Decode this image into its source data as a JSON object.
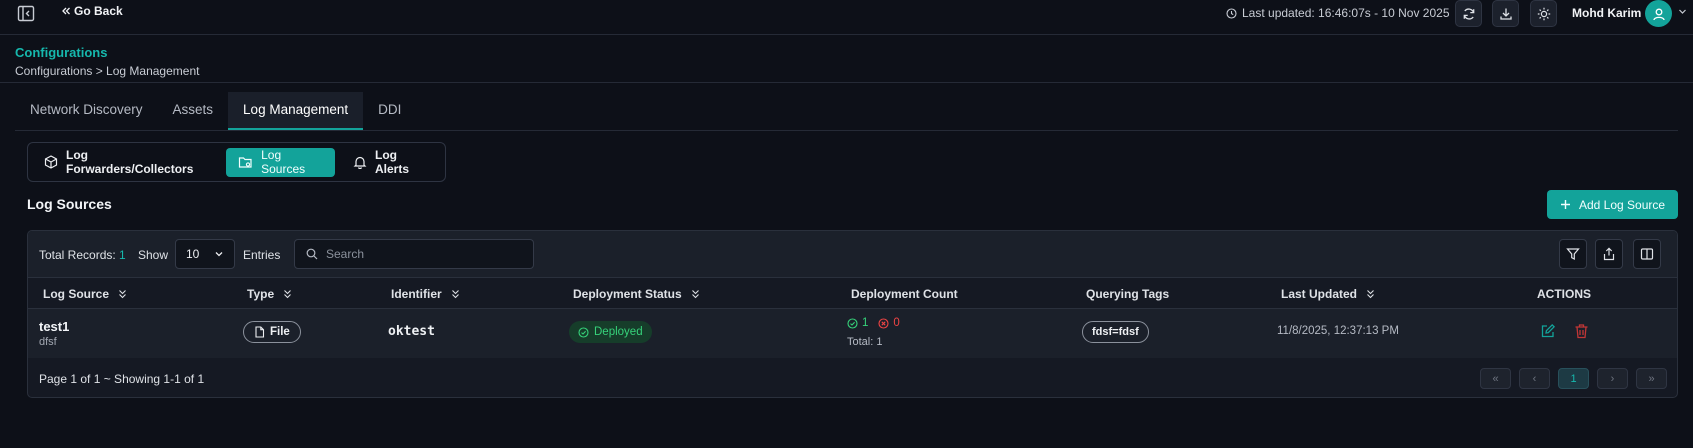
{
  "topbar": {
    "go_back": "Go Back",
    "last_updated": "Last updated: 16:46:07s - 10 Nov 2025",
    "user_name": "Mohd Karim"
  },
  "header": {
    "title": "Configurations",
    "breadcrumb": "Configurations > Log Management"
  },
  "tabs": [
    "Network Discovery",
    "Assets",
    "Log Management",
    "DDI"
  ],
  "active_tab": "Log Management",
  "subtabs": [
    "Log Forwarders/Collectors",
    "Log Sources",
    "Log Alerts"
  ],
  "active_subtab": "Log Sources",
  "section": {
    "title": "Log Sources",
    "add_button": "Add Log Source"
  },
  "toolbar": {
    "total_label": "Total Records:",
    "total_value": "1",
    "show_label": "Show",
    "page_size": "10",
    "entries_label": "Entries",
    "search_placeholder": "Search"
  },
  "table": {
    "columns": [
      "Log Source",
      "Type",
      "Identifier",
      "Deployment Status",
      "Deployment Count",
      "Querying Tags",
      "Last Updated",
      "ACTIONS"
    ],
    "rows": [
      {
        "name": "test1",
        "description": "dfsf",
        "type": "File",
        "identifier": "oktest",
        "status": "Deployed",
        "success_count": "1",
        "failed_count": "0",
        "total": "Total: 1",
        "tag": "fdsf=fdsf",
        "last_updated": "11/8/2025, 12:37:13 PM"
      }
    ]
  },
  "pagination": {
    "info": "Page 1 of 1 ~ Showing 1-1 of 1",
    "current_page": "1",
    "first": "«",
    "prev": "‹",
    "next": "›",
    "last": "»"
  },
  "colors": {
    "accent": "#13a39a",
    "success": "#36d27a",
    "danger": "#ef4444",
    "background": "#0d1018"
  }
}
